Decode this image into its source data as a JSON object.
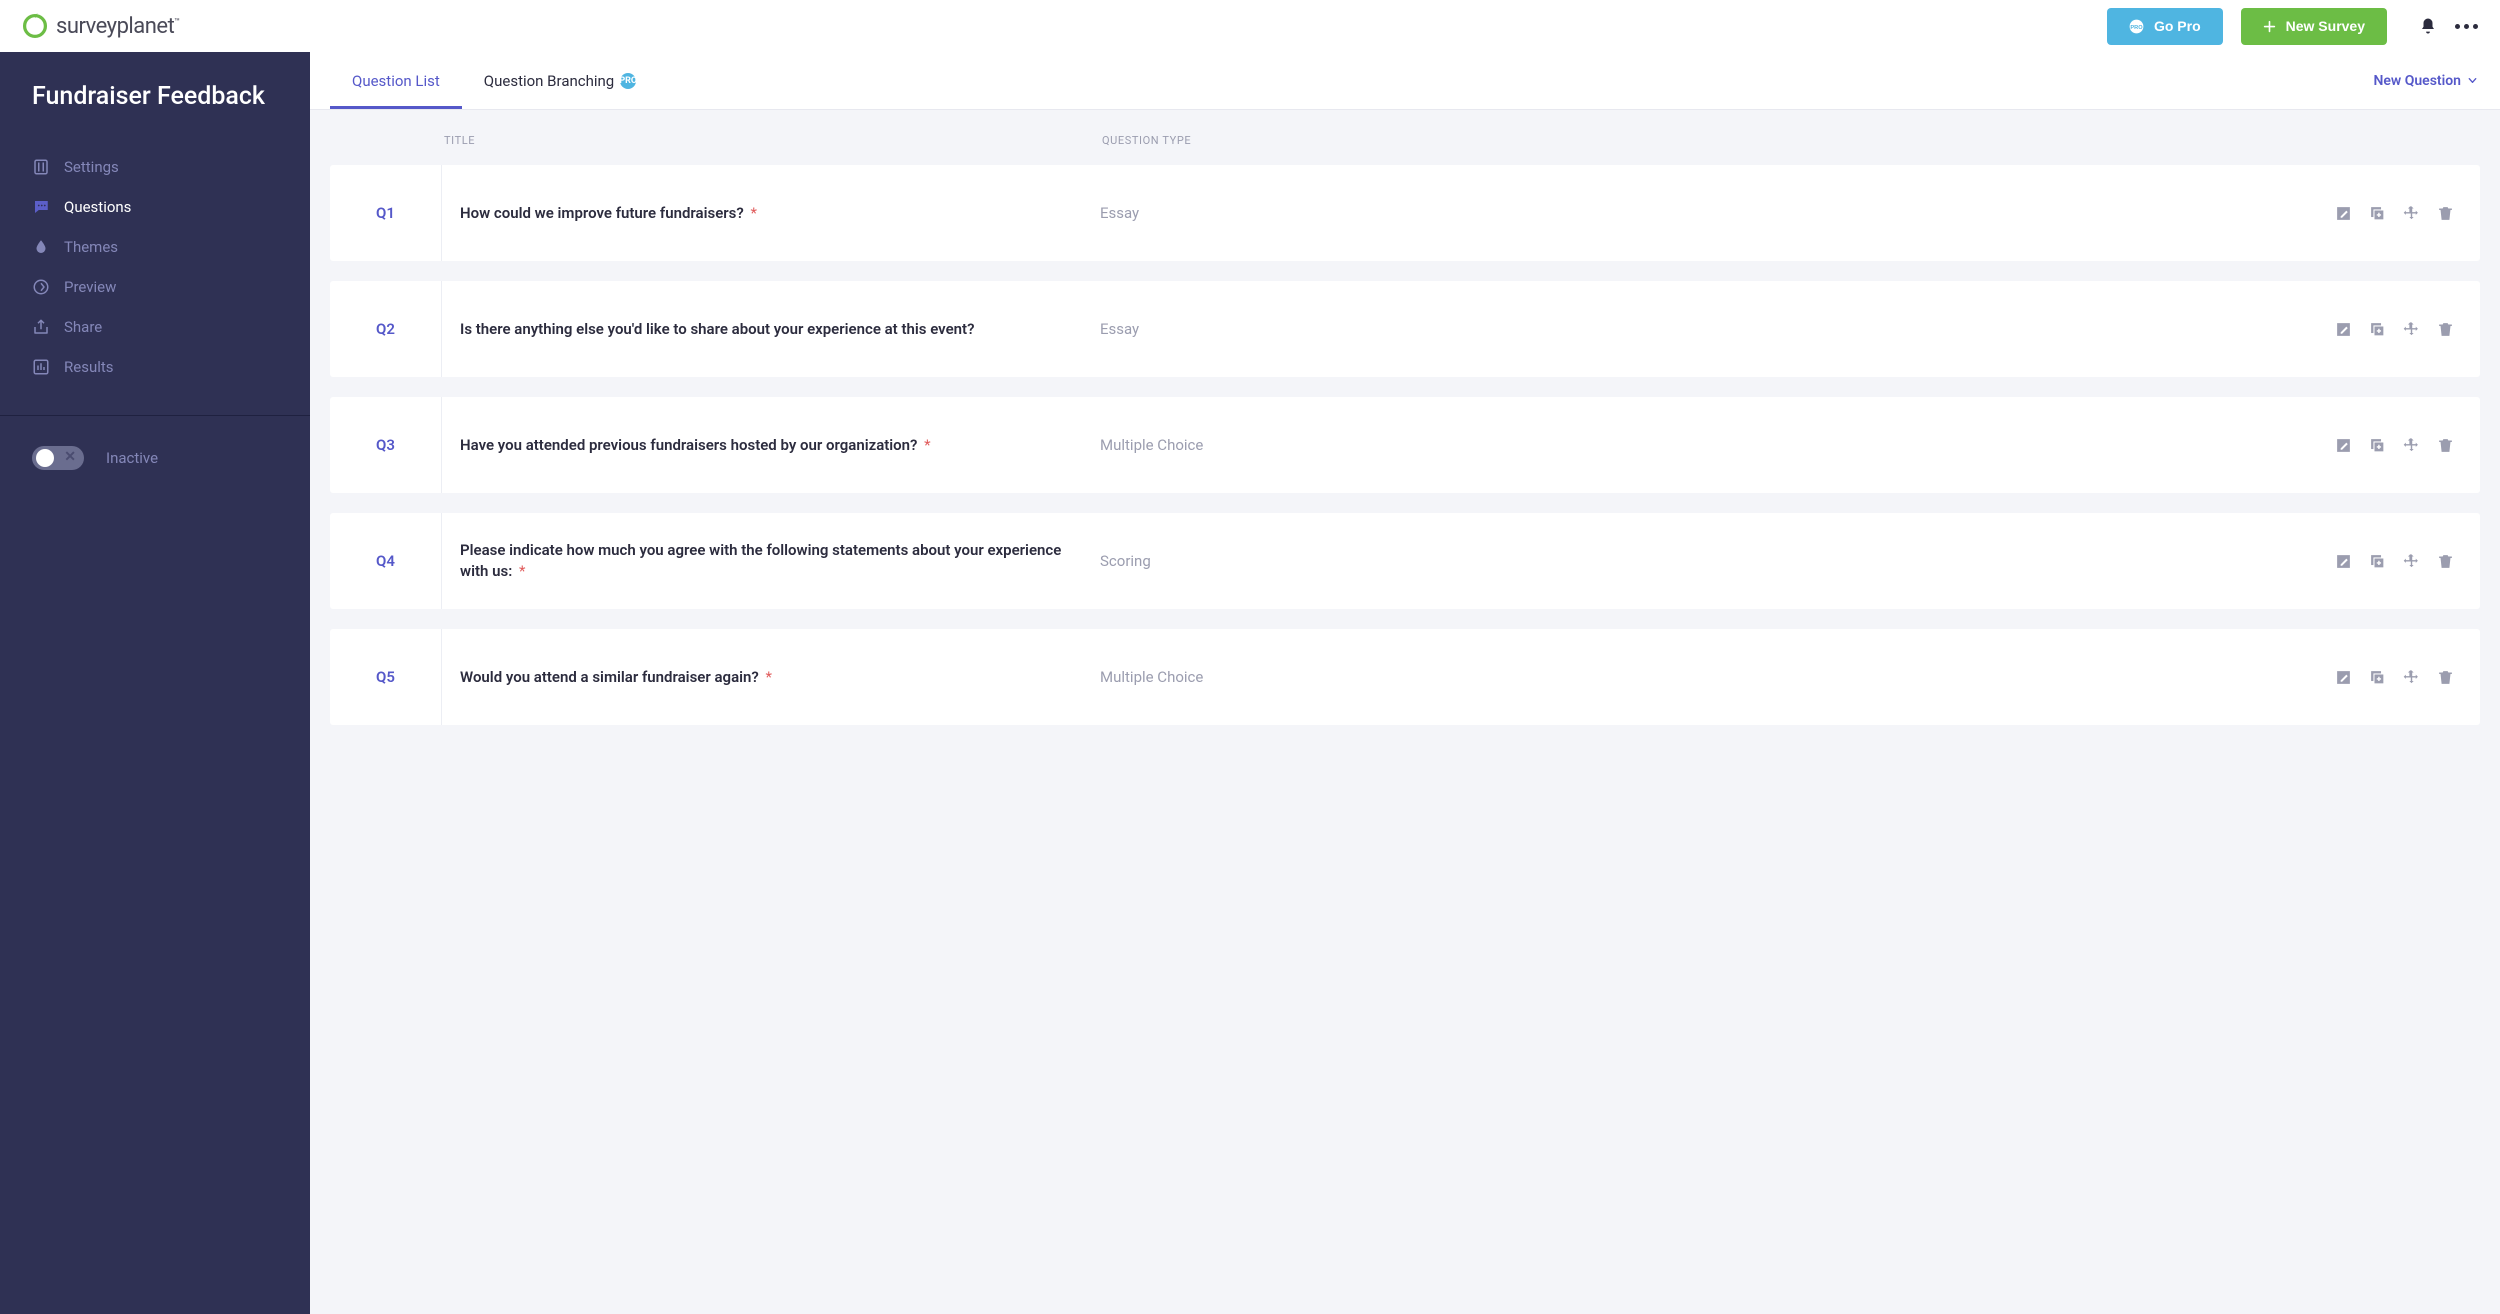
{
  "header": {
    "brand": "surveyplanet",
    "gopro_label": "Go Pro",
    "newsurvey_label": "New Survey"
  },
  "sidebar": {
    "title": "Fundraiser Feedback",
    "items": [
      {
        "label": "Settings",
        "icon": "sliders"
      },
      {
        "label": "Questions",
        "icon": "comment",
        "active": true
      },
      {
        "label": "Themes",
        "icon": "drop"
      },
      {
        "label": "Preview",
        "icon": "target"
      },
      {
        "label": "Share",
        "icon": "share"
      },
      {
        "label": "Results",
        "icon": "chart"
      }
    ],
    "toggle_label": "Inactive"
  },
  "tabs": {
    "list_label": "Question List",
    "branching_label": "Question Branching",
    "new_question_label": "New Question"
  },
  "list": {
    "col_title": "TITLE",
    "col_qtype": "QUESTION TYPE"
  },
  "questions": [
    {
      "num": "Q1",
      "title": "How could we improve future fundraisers?",
      "required": true,
      "type": "Essay"
    },
    {
      "num": "Q2",
      "title": "Is there anything else you'd like to share about your experience at this event?",
      "required": false,
      "type": "Essay"
    },
    {
      "num": "Q3",
      "title": "Have you attended previous fundraisers hosted by our organization?",
      "required": true,
      "type": "Multiple Choice"
    },
    {
      "num": "Q4",
      "title": "Please indicate how much you agree with the following statements about your experience with us:",
      "required": true,
      "type": "Scoring"
    },
    {
      "num": "Q5",
      "title": "Would you attend a similar fundraiser again?",
      "required": true,
      "type": "Multiple Choice"
    }
  ]
}
